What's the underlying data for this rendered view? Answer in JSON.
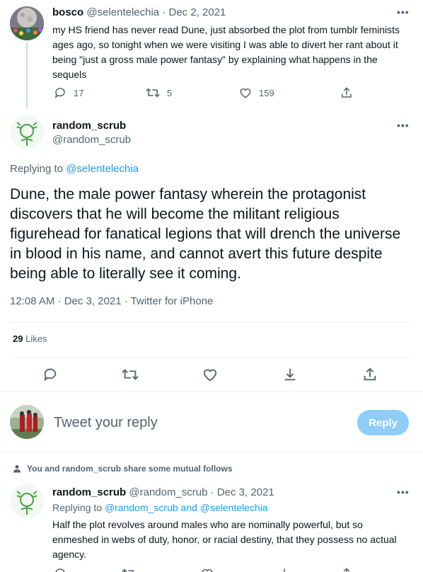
{
  "tweet1": {
    "display_name": "bosco",
    "handle": "@selentelechia",
    "date": "Dec 2, 2021",
    "text": "my HS friend has never read Dune, just absorbed the plot from tumblr feminists ages ago, so tonight when we were visiting I was able to divert her rant about it being \"just a gross male power fantasy\" by explaining what happens in the sequels",
    "replies": "17",
    "retweets": "5",
    "likes": "159"
  },
  "main_tweet": {
    "display_name": "random_scrub",
    "handle": "@random_scrub",
    "replying_prefix": "Replying to",
    "replying_to": "@selentelechia",
    "text": "Dune, the male power fantasy wherein the protagonist discovers that he will become the militant religious figurehead for fanatical legions that will drench the universe in blood in his name, and cannot avert this future despite being able to literally see it coming.",
    "timestamp": "12:08 AM · Dec 3, 2021 · Twitter for iPhone",
    "likes_count": "29",
    "likes_label": "Likes"
  },
  "composer": {
    "placeholder": "Tweet your reply",
    "reply_label": "Reply"
  },
  "mutual_notice": "You and random_scrub share some mutual follows",
  "tweet3": {
    "display_name": "random_scrub",
    "handle": "@random_scrub",
    "date": "Dec 3, 2021",
    "replying_prefix": "Replying to",
    "replying_to": "@random_scrub and @selentelechia",
    "text": "Half the plot revolves around males who are nominally powerful, but so enmeshed in webs of duty, honor, or racial destiny, that they possess no actual agency."
  },
  "separator": "·",
  "more_glyph": "•••",
  "colors": {
    "accent": "#1d9bf0",
    "muted": "#536471",
    "reply_button": "#8ecdf8"
  }
}
